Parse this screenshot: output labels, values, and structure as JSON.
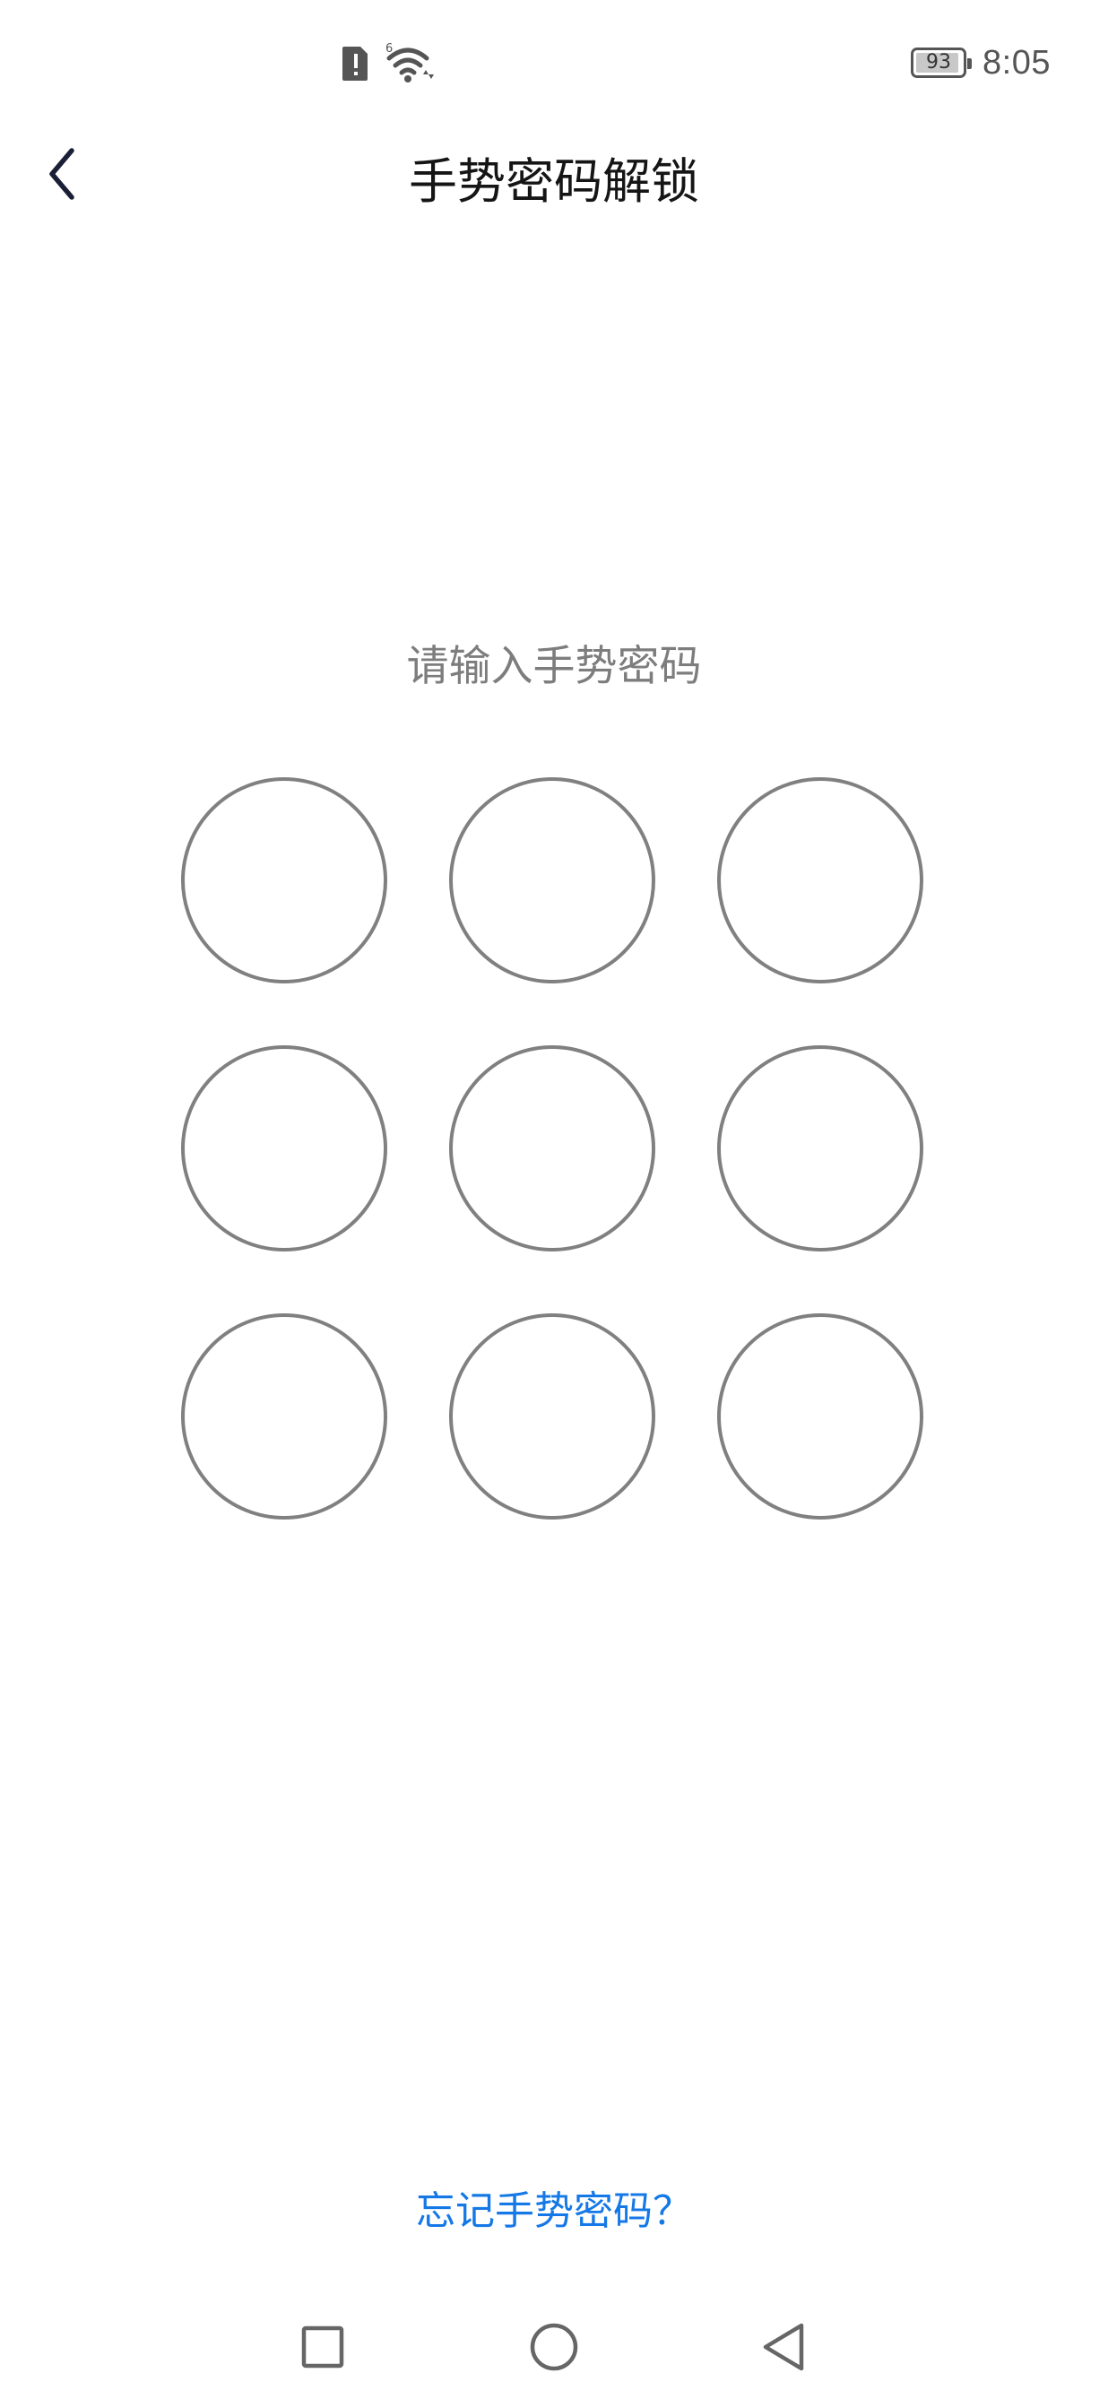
{
  "status_bar": {
    "time": "8:05",
    "battery_level": "93",
    "battery_fraction": 0.93,
    "signal_label": "6",
    "icons": [
      "sim-alert-icon",
      "wifi-icon",
      "battery-icon"
    ]
  },
  "header": {
    "title": "手势密码解锁",
    "back_icon": "chevron-left-icon"
  },
  "main": {
    "prompt": "请输入手势密码",
    "pattern_dots": 9
  },
  "footer": {
    "forgot_link": "忘记手势密码？"
  },
  "nav_bar": {
    "icons": [
      "recent-apps-icon",
      "home-icon",
      "back-triangle-icon"
    ]
  },
  "colors": {
    "link": "#1478e6",
    "dot_stroke": "#808080",
    "prompt_text": "#7d7d7d",
    "title_text": "#151515"
  }
}
